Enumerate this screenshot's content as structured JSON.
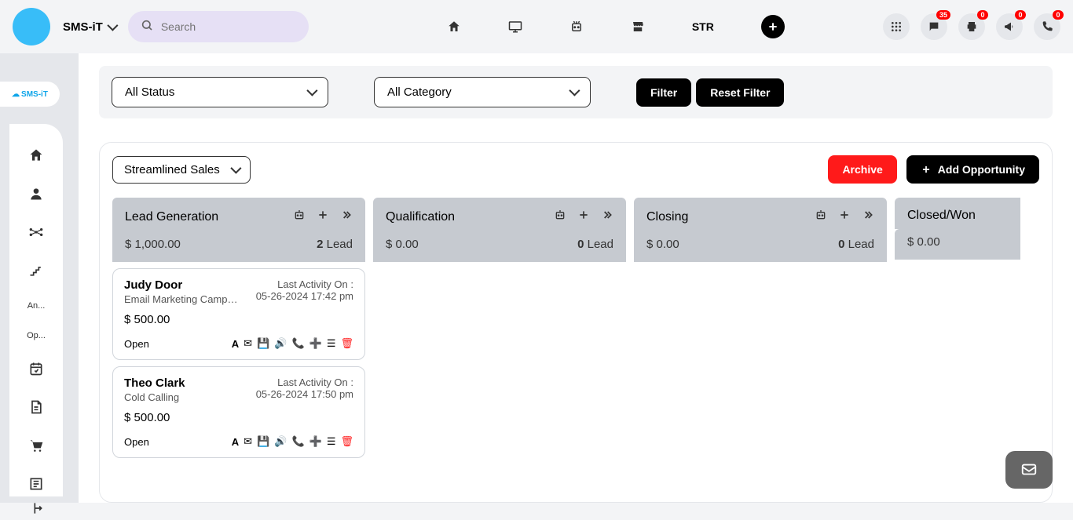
{
  "header": {
    "brand": "SMS-iT",
    "search_placeholder": "Search",
    "str": "STR",
    "badges": {
      "chat": "35",
      "print": "0",
      "megaphone": "0",
      "phone": "0"
    }
  },
  "sidebar": {
    "items": [
      {
        "label": ""
      },
      {
        "label": ""
      },
      {
        "label": ""
      },
      {
        "label": ""
      },
      {
        "label": "An..."
      },
      {
        "label": "Op..."
      }
    ]
  },
  "filters": {
    "status": "All Status",
    "category": "All Category",
    "filter_btn": "Filter",
    "reset_btn": "Reset Filter"
  },
  "board": {
    "pipeline": "Streamlined Sales",
    "archive": "Archive",
    "add_opportunity": "Add Opportunity",
    "last_activity_label": "Last Activity On :",
    "columns": [
      {
        "title": "Lead Generation",
        "amount": "$ 1,000.00",
        "count": "2",
        "count_label": "Lead",
        "cards": [
          {
            "name": "Judy Door",
            "sub": "Email Marketing Campaign",
            "activity": "05-26-2024 17:42 pm",
            "amount": "$ 500.00",
            "status": "Open"
          },
          {
            "name": "Theo Clark",
            "sub": "Cold Calling",
            "activity": "05-26-2024 17:50 pm",
            "amount": "$ 500.00",
            "status": "Open"
          }
        ]
      },
      {
        "title": "Qualification",
        "amount": "$ 0.00",
        "count": "0",
        "count_label": "Lead",
        "cards": []
      },
      {
        "title": "Closing",
        "amount": "$ 0.00",
        "count": "0",
        "count_label": "Lead",
        "cards": []
      },
      {
        "title": "Closed/Won",
        "amount": "$ 0.00",
        "count": "",
        "count_label": "",
        "cards": []
      }
    ]
  }
}
